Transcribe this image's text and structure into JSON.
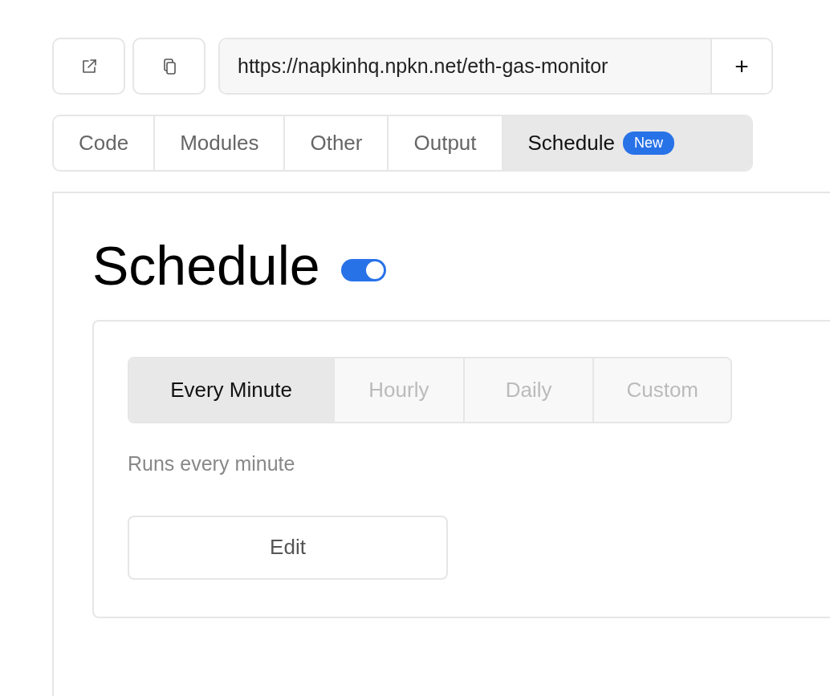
{
  "toolbar": {
    "url": "https://napkinhq.npkn.net/eth-gas-monitor",
    "add_button": "+"
  },
  "tabs": [
    {
      "label": "Code",
      "selected": false
    },
    {
      "label": "Modules",
      "selected": false
    },
    {
      "label": "Other",
      "selected": false
    },
    {
      "label": "Output",
      "selected": false
    },
    {
      "label": "Schedule",
      "selected": true,
      "badge": "New"
    }
  ],
  "schedule": {
    "title": "Schedule",
    "enabled": true,
    "frequencies": [
      {
        "label": "Every Minute",
        "selected": true
      },
      {
        "label": "Hourly",
        "selected": false
      },
      {
        "label": "Daily",
        "selected": false
      },
      {
        "label": "Custom",
        "selected": false
      }
    ],
    "description": "Runs every minute",
    "edit_button": "Edit"
  }
}
